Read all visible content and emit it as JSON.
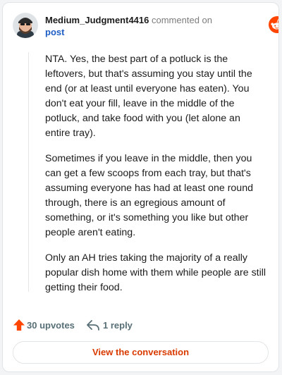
{
  "header": {
    "username": "Medium_Judgment4416",
    "commented_text": "commented on",
    "post_link": "post",
    "brand": "reddit",
    "avatar_icon": "snoo-avatar-icon",
    "brand_icon": "reddit-logo-icon"
  },
  "comment": {
    "paragraphs": [
      "NTA. Yes, the best part of a potluck is the leftovers, but that's assuming you stay until the end (or at least until everyone has eaten). You don't eat your fill, leave in the middle of the potluck, and take food with you (let alone an entire tray).",
      "Sometimes if you leave in the middle, then you can get a few scoops from each tray, but that's assuming everyone has had at least one round through, there is an egregious amount of something, or it's something you like but other people aren't eating.",
      "Only an AH tries taking the majority of a really popular dish home with them while people are still getting their food."
    ]
  },
  "actions": {
    "upvotes": "30 upvotes",
    "replies": "1 reply",
    "upvote_icon": "upvote-arrow-icon",
    "reply_icon": "reply-arrow-icon"
  },
  "footer": {
    "view_button": "View the conversation"
  },
  "colors": {
    "accent": "#d93a00",
    "upvote": "#ff4500",
    "link": "#1d5ec5",
    "muted": "#576f76"
  }
}
